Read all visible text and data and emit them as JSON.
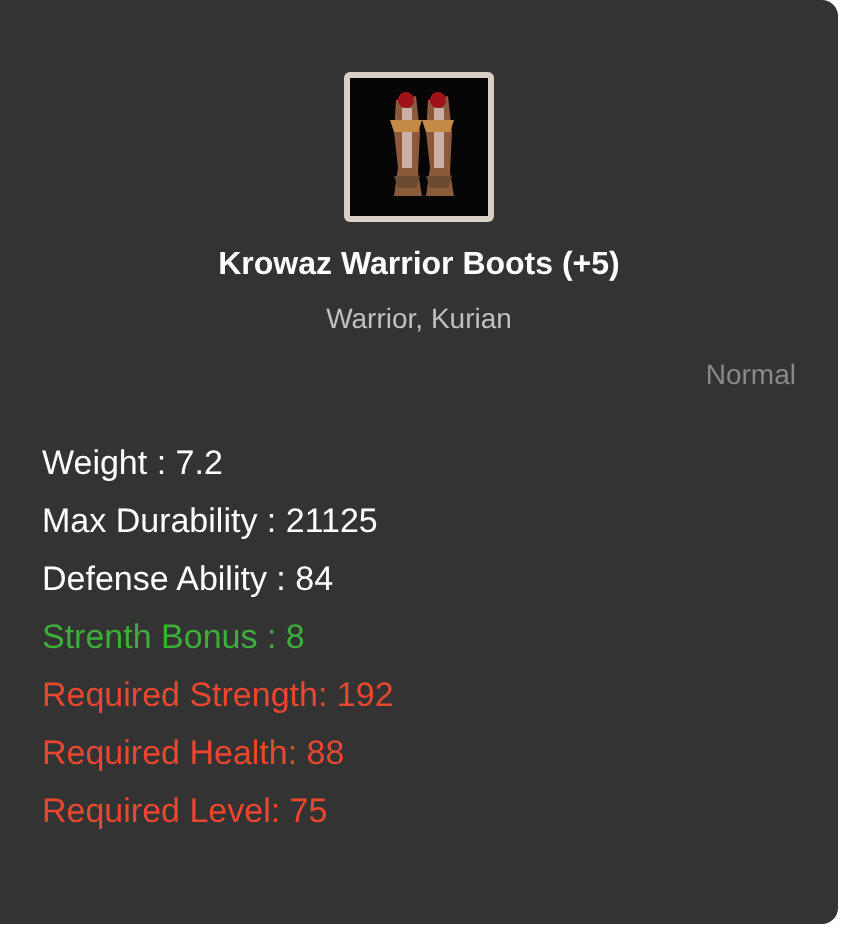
{
  "item": {
    "name": "Krowaz Warrior Boots (+5)",
    "classes": "Warrior, Kurian",
    "grade": "Normal"
  },
  "stats": [
    {
      "text": "Weight : 7.2",
      "kind": "base"
    },
    {
      "text": "Max Durability : 21125",
      "kind": "base"
    },
    {
      "text": "Defense Ability : 84",
      "kind": "base"
    },
    {
      "text": "Strenth Bonus : 8",
      "kind": "bonus"
    },
    {
      "text": "Required Strength: 192",
      "kind": "requirement"
    },
    {
      "text": "Required Health: 88",
      "kind": "requirement"
    },
    {
      "text": "Required Level: 75",
      "kind": "requirement"
    }
  ]
}
